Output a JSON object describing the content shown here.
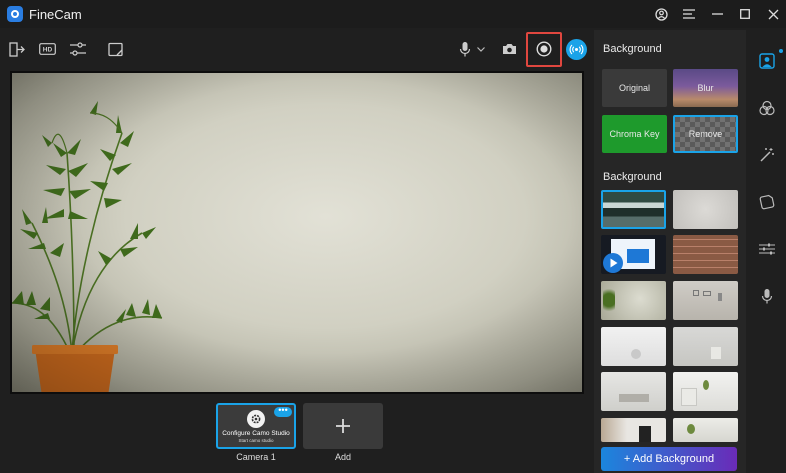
{
  "app": {
    "title": "FineCam"
  },
  "panel": {
    "background_heading": "Background",
    "options": [
      {
        "label": "Original"
      },
      {
        "label": "Blur"
      },
      {
        "label": "Chroma Key"
      },
      {
        "label": "Remove"
      }
    ],
    "gallery_heading": "Background",
    "add_background_label": "+ Add Background"
  },
  "cameras": {
    "tile_title": "Configure Camo Studio",
    "tile_subtitle": "Start camo studio",
    "camera_label": "Camera 1",
    "add_label": "Add",
    "more_label": "•••"
  },
  "colors": {
    "accent": "#1aa3e8",
    "record_highlight": "#e0473f",
    "chroma": "#1e9a2c"
  },
  "icons": [
    "exit-icon",
    "hd-icon",
    "settings-sliders-icon",
    "note-icon",
    "mic-icon",
    "camera-icon",
    "record-icon",
    "live-icon",
    "person-icon",
    "effects-icon",
    "magic-wand-icon",
    "sticker-icon",
    "adjust-icon",
    "mic-rail-icon"
  ]
}
